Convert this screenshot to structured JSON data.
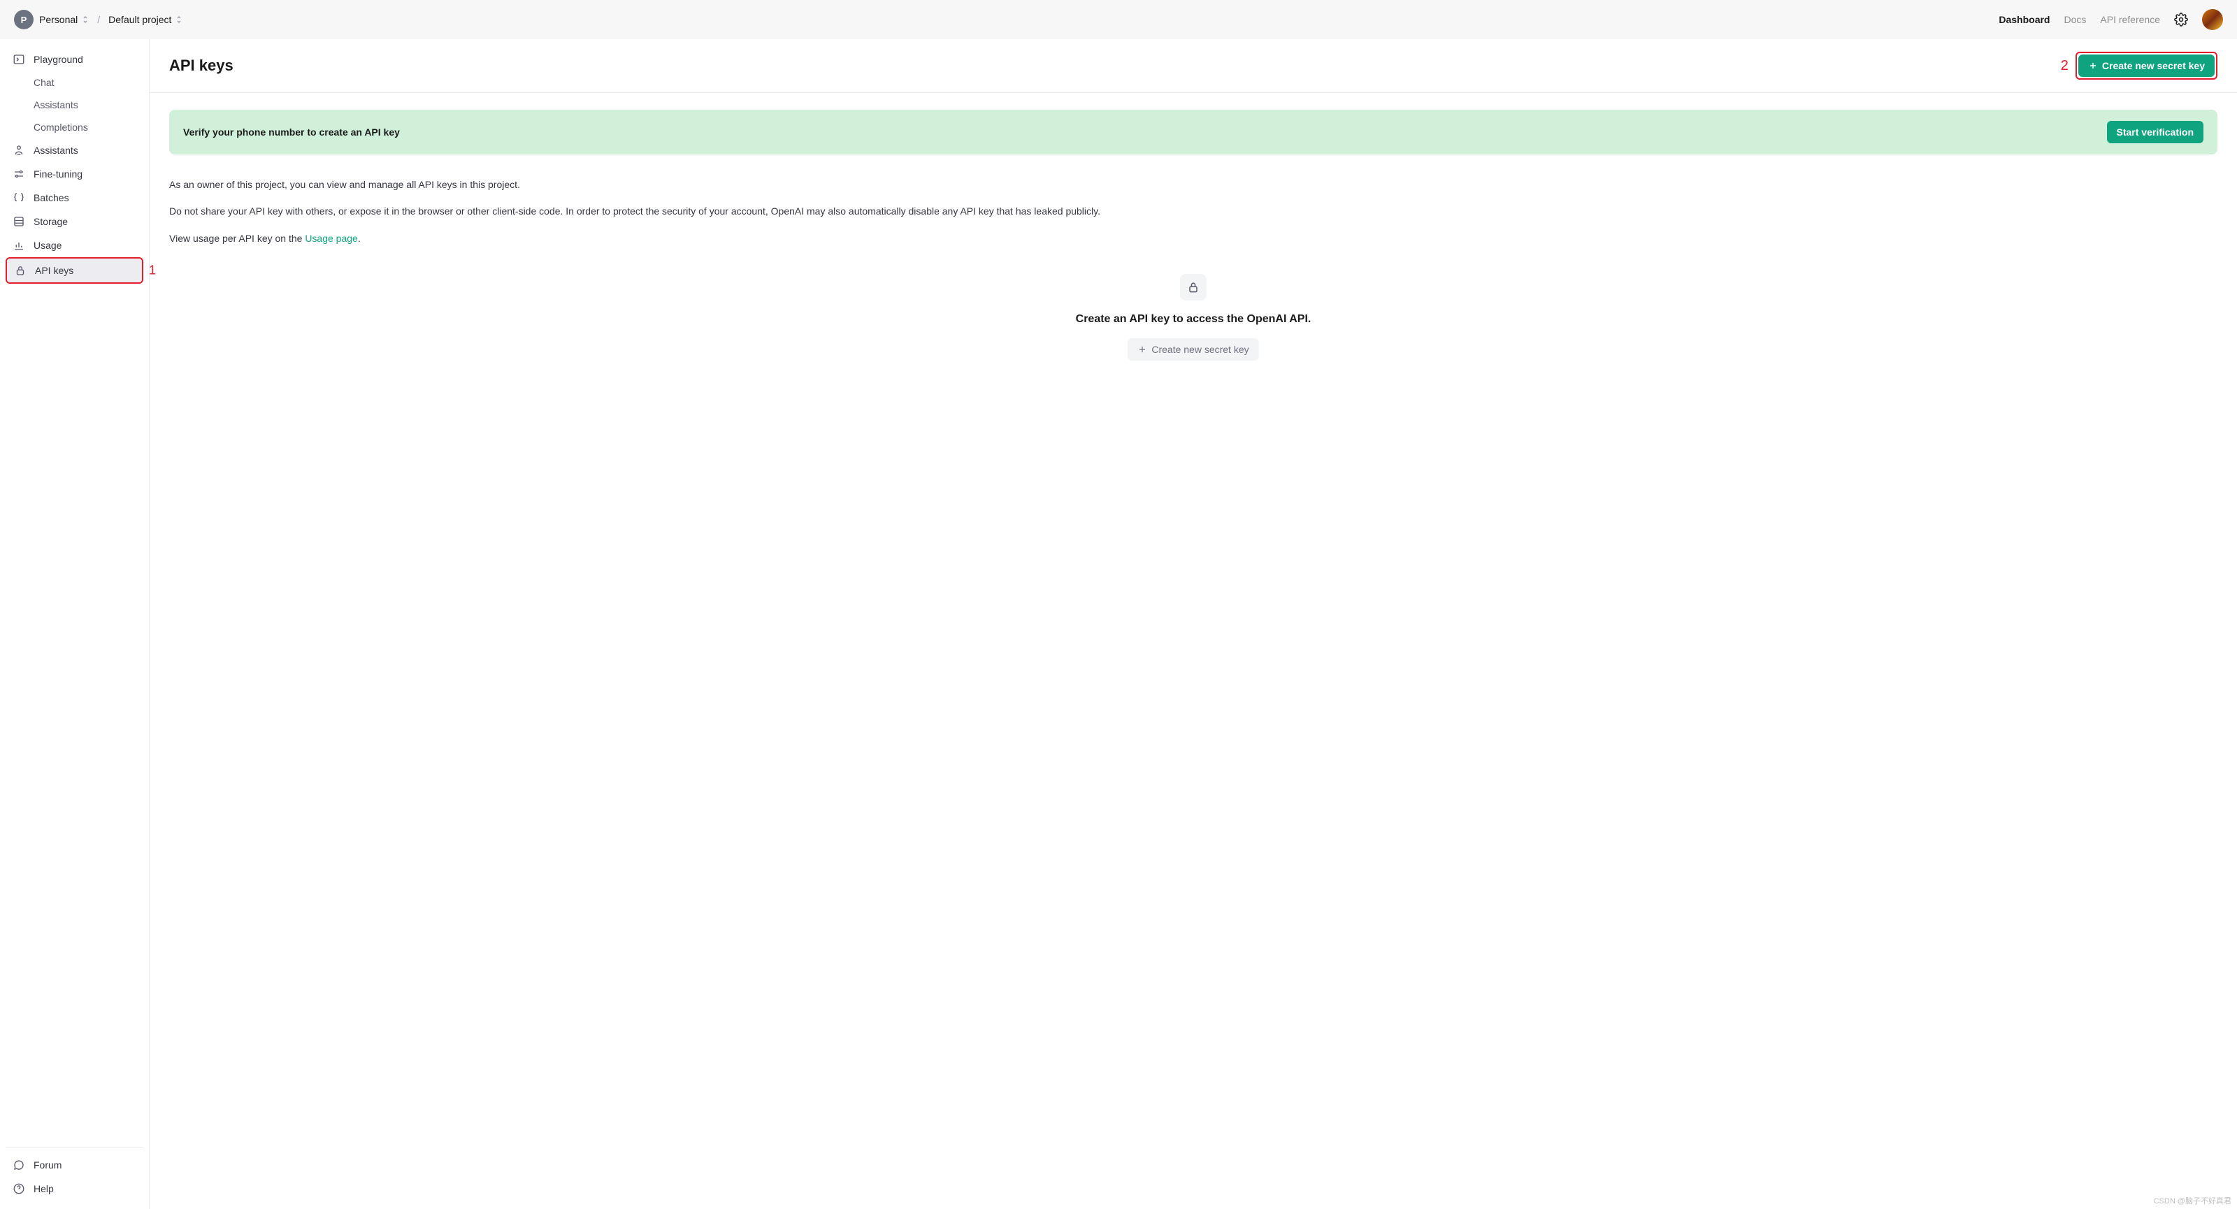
{
  "topbar": {
    "org_initial": "P",
    "org_name": "Personal",
    "project_name": "Default project",
    "nav": {
      "dashboard": "Dashboard",
      "docs": "Docs",
      "api_reference": "API reference"
    }
  },
  "sidebar": {
    "items": [
      {
        "label": "Playground",
        "icon": "terminal"
      },
      {
        "label": "Chat",
        "sub": true
      },
      {
        "label": "Assistants",
        "sub": true
      },
      {
        "label": "Completions",
        "sub": true
      },
      {
        "label": "Assistants",
        "icon": "robot"
      },
      {
        "label": "Fine-tuning",
        "icon": "sliders"
      },
      {
        "label": "Batches",
        "icon": "braces"
      },
      {
        "label": "Storage",
        "icon": "storage"
      },
      {
        "label": "Usage",
        "icon": "chart"
      },
      {
        "label": "API keys",
        "icon": "lock",
        "active": true,
        "highlight": true
      }
    ],
    "bottom": [
      {
        "label": "Forum",
        "icon": "chat-bubble"
      },
      {
        "label": "Help",
        "icon": "question"
      }
    ]
  },
  "annotations": {
    "marker1": "1",
    "marker2": "2"
  },
  "page": {
    "title": "API keys",
    "create_button": "Create new secret key",
    "notice": {
      "text": "Verify your phone number to create an API key",
      "button": "Start verification"
    },
    "body": {
      "para1": "As an owner of this project, you can view and manage all API keys in this project.",
      "para2": "Do not share your API key with others, or expose it in the browser or other client-side code. In order to protect the security of your account, OpenAI may also automatically disable any API key that has leaked publicly.",
      "para3_prefix": "View usage per API key on the ",
      "para3_link": "Usage page",
      "para3_suffix": "."
    },
    "empty": {
      "title": "Create an API key to access the OpenAI API.",
      "button": "Create new secret key"
    }
  },
  "watermark": "CSDN @脑子不好真君"
}
